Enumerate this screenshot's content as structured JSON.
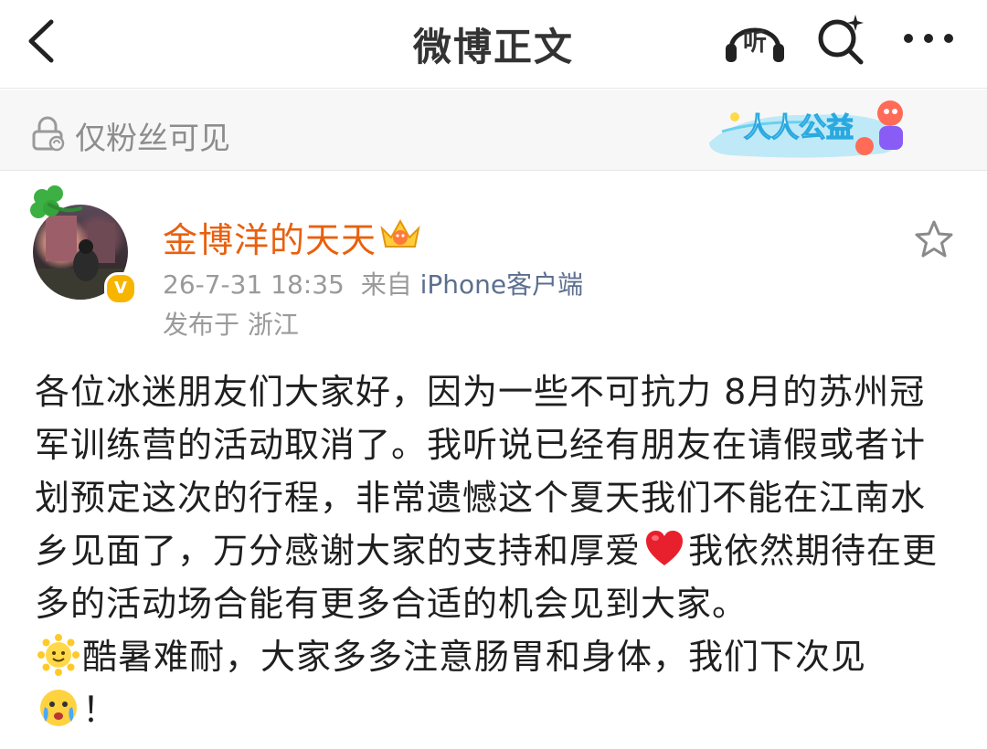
{
  "header": {
    "title": "微博正文",
    "listen_label": "听",
    "icons": [
      "back-arrow-icon",
      "headphones-icon",
      "search-sparkle-icon",
      "more-dots-icon"
    ]
  },
  "visibility": {
    "label": "仅粉丝可见",
    "icon": "lock-icon"
  },
  "charity_banner": {
    "label": "人人公益"
  },
  "author": {
    "name": "金博洋的天天",
    "verified_badge": "V",
    "timestamp": "26-7-31 18:35",
    "source_prefix": "来自",
    "source": "iPhone客户端",
    "location_prefix": "发布于",
    "location": "浙江"
  },
  "post": {
    "part1": "各位冰迷朋友们大家好，因为一些不可抗力 8月的苏州冠军训练营的活动取消了。我听说已经有朋友在请假或者计划预定这次的行程，非常遗憾这个夏天我们不能在江南水乡见面了，万分感谢大家的支持和厚爱",
    "part2": "我依然期待在更多的活动场合能有更多合适的机会见到大家。",
    "part3": "酷暑难耐，大家多多注意肠胃和身体，我们下次见",
    "part4": "！",
    "emojis": [
      "red-heart-emoji",
      "sun-face-emoji",
      "tearful-face-emoji"
    ]
  },
  "colors": {
    "author_name": "#e8600f",
    "source_link": "#5c6f8f",
    "muted": "#9a9a9a",
    "verify_badge": "#f7b500"
  }
}
